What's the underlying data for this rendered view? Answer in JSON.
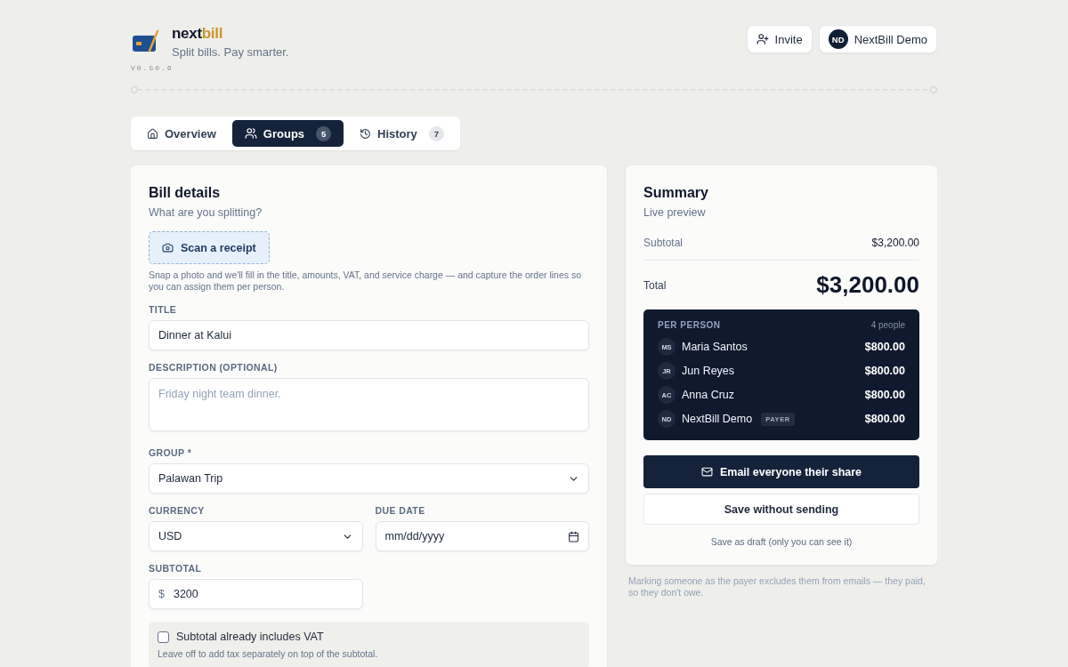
{
  "header": {
    "brand_first": "next",
    "brand_second": "bill",
    "tagline": "Split bills. Pay smarter.",
    "version": "V0.50.6",
    "invite": "Invite",
    "user": {
      "initials": "ND",
      "name": "NextBill Demo"
    }
  },
  "tabs": [
    {
      "label": "Overview",
      "selected": false
    },
    {
      "label": "Groups",
      "count": "5",
      "selected": true
    },
    {
      "label": "History",
      "count": "7",
      "selected": false
    }
  ],
  "bill": {
    "title": "Bill details",
    "subtitle": "What are you splitting?",
    "scan_button": "Scan a receipt",
    "scan_hint": "Snap a photo and we'll fill in the title, amounts, VAT, and service charge — and capture the order lines so you can assign them per person.",
    "title_label": "TITLE",
    "title_value": "Dinner at Kalui",
    "description_label": "DESCRIPTION (OPTIONAL)",
    "description_placeholder": "Friday night team dinner.",
    "group_label": "GROUP *",
    "group_value": "Palawan Trip",
    "currency_label": "CURRENCY",
    "currency_value": "USD",
    "due_label": "DUE DATE",
    "due_placeholder": "mm/dd/yyyy",
    "subtotal_label": "SUBTOTAL",
    "subtotal_prefix": "$",
    "subtotal_value": "3200",
    "vat": {
      "label": "Subtotal already includes VAT",
      "checked": false,
      "hint": "Leave off to add tax separately on top of the subtotal."
    }
  },
  "summary": {
    "title": "Summary",
    "subtitle": "Live preview",
    "subtotal_label": "Subtotal",
    "subtotal_value": "$3,200.00",
    "total_label": "Total",
    "total_value": "$3,200.00",
    "per_person_label": "PER PERSON",
    "people_count": "4 people",
    "people": [
      {
        "initials": "MS",
        "name": "Maria Santos",
        "amount": "$800.00"
      },
      {
        "initials": "JR",
        "name": "Jun Reyes",
        "amount": "$800.00"
      },
      {
        "initials": "AC",
        "name": "Anna Cruz",
        "amount": "$800.00"
      },
      {
        "initials": "ND",
        "name": "NextBill Demo",
        "badge": "PAYER",
        "amount": "$800.00"
      }
    ],
    "email_button": "Email everyone their share",
    "save_button": "Save without sending",
    "draft_link": "Save as draft (only you can see it)"
  },
  "note": "Marking someone as the payer excludes them from emails — they paid, so they don't owe."
}
